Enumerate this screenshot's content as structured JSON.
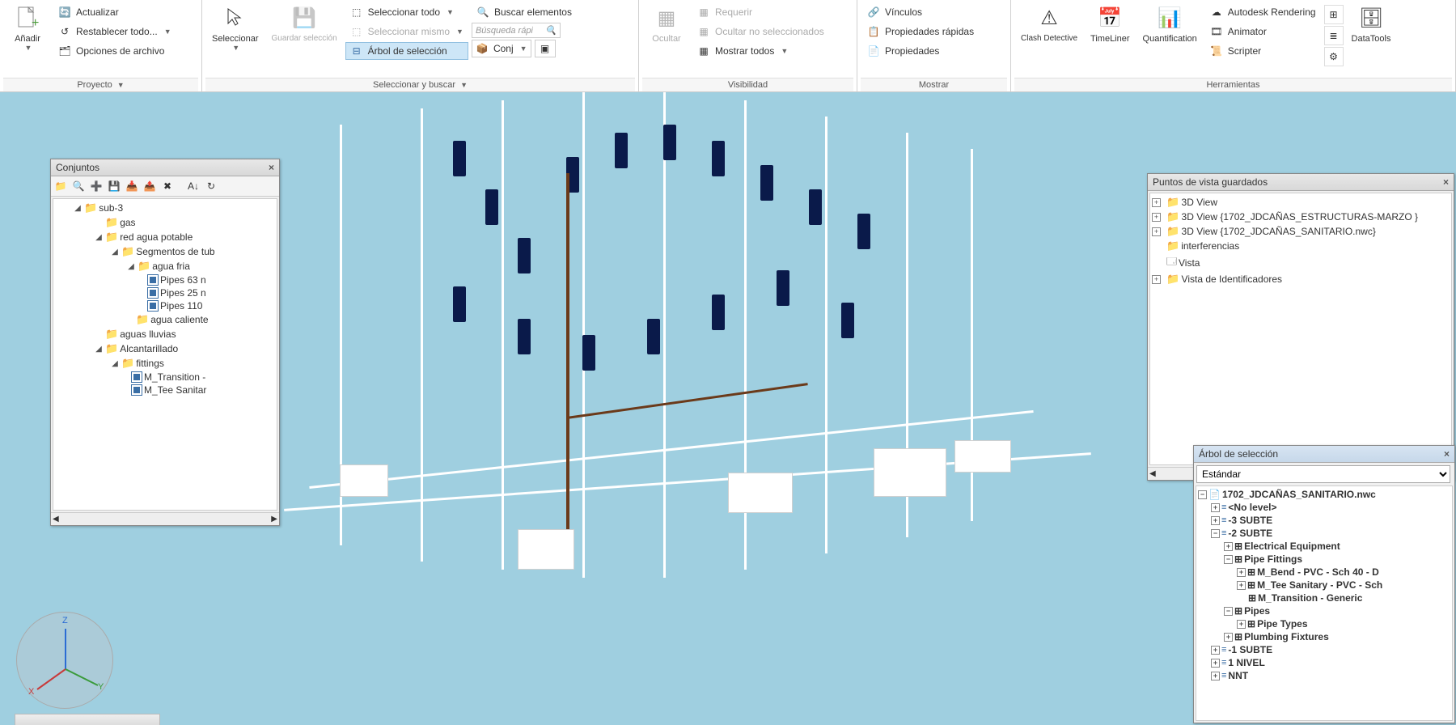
{
  "ribbon": {
    "groups": {
      "proyecto": {
        "label": "Proyecto",
        "anadir": "Añadir",
        "actualizar": "Actualizar",
        "restablecer": "Restablecer todo...",
        "opciones": "Opciones de archivo"
      },
      "seleccionar": {
        "label": "Seleccionar y buscar",
        "seleccionar": "Seleccionar",
        "guardar": "Guardar selección",
        "sel_todo": "Seleccionar todo",
        "sel_mismo": "Seleccionar mismo",
        "arbol": "Árbol de selección",
        "buscar": "Buscar elementos",
        "busqueda_ph": "Búsqueda rápi",
        "conj": "Conj"
      },
      "visibilidad": {
        "label": "Visibilidad",
        "ocultar": "Ocultar",
        "requerir": "Requerir",
        "ocultar_no": "Ocultar no seleccionados",
        "mostrar_todos": "Mostrar todos"
      },
      "mostrar": {
        "label": "Mostrar",
        "vinculos": "Vínculos",
        "prop_rapidas": "Propiedades rápidas",
        "propiedades": "Propiedades"
      },
      "herramientas": {
        "label": "Herramientas",
        "clash": "Clash Detective",
        "timeliner": "TimeLiner",
        "quant": "Quantification",
        "rendering": "Autodesk Rendering",
        "animator": "Animator",
        "scripter": "Scripter",
        "datatools": "DataTools"
      }
    }
  },
  "panels": {
    "conjuntos": {
      "title": "Conjuntos",
      "tree": {
        "sub3": "sub-3",
        "gas": "gas",
        "red_agua": "red agua potable",
        "segmentos": "Segmentos de tub",
        "agua_fria": "agua fria",
        "pipes63": "Pipes 63 n",
        "pipes25": "Pipes 25 n",
        "pipes110": "Pipes 110",
        "agua_caliente": "agua caliente",
        "aguas_lluvias": "aguas lluvias",
        "alcantarillado": "Alcantarillado",
        "fittings": "fittings",
        "m_transition": "M_Transition -",
        "m_tee": "M_Tee Sanitar"
      }
    },
    "puntos": {
      "title": "Puntos de vista guardados",
      "items": {
        "v3d": "3D View",
        "v3d_estr": "3D View {1702_JDCAÑAS_ESTRUCTURAS-MARZO }",
        "v3d_san": "3D View {1702_JDCAÑAS_SANITARIO.nwc}",
        "interf": "interferencias",
        "vista": "Vista",
        "vista_id": "Vista de Identificadores"
      }
    },
    "arbol": {
      "title": "Árbol de selección",
      "dropdown": "Estándar",
      "root": "1702_JDCAÑAS_SANITARIO.nwc",
      "nolevel": "<No level>",
      "s3": "-3 SUBTE",
      "s2": "-2 SUBTE",
      "elec": "Electrical Equipment",
      "pipe_fit": "Pipe Fittings",
      "mbend": "M_Bend - PVC - Sch 40 - D",
      "mtee": "M_Tee Sanitary - PVC - Sch",
      "mtrans": "M_Transition - Generic",
      "pipes": "Pipes",
      "pipe_types": "Pipe Types",
      "plumb": "Plumbing Fixtures",
      "s1": "-1 SUBTE",
      "n1": "1 NIVEL",
      "nnt": "NNT"
    }
  },
  "compass": {
    "x": "X",
    "y": "Y",
    "z": "Z"
  }
}
